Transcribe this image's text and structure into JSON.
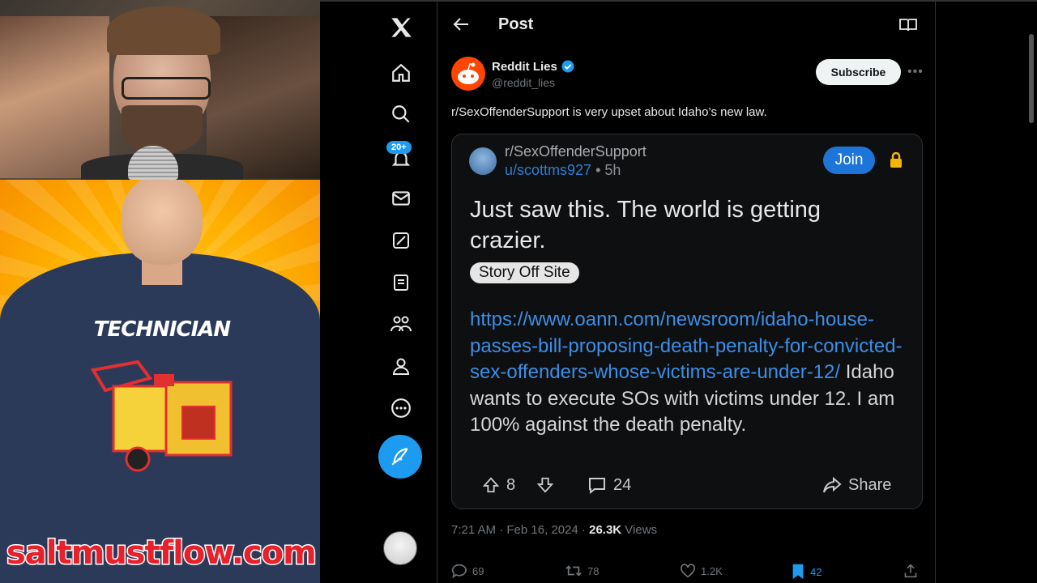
{
  "overlay": {
    "site": "saltmustflow.com",
    "shirt_text": "TECHNICIAN"
  },
  "nav": {
    "notifications_badge": "20+"
  },
  "header": {
    "title": "Post"
  },
  "author": {
    "name": "Reddit Lies",
    "handle": "@reddit_lies",
    "subscribe_label": "Subscribe"
  },
  "tweet": {
    "text": "r/SexOffenderSupport is very upset about Idaho’s new law."
  },
  "reddit": {
    "subreddit": "r/SexOffenderSupport",
    "user": "u/scottms927",
    "time": "• 5h",
    "join_label": "Join",
    "title": "Just saw this. The world is getting crazier.",
    "flair": "Story Off Site",
    "link": "https://www.oann.com/newsroom/idaho-house-passes-bill-proposing-death-penalty-for-convicted-sex-offenders-whose-victims-are-under-12/",
    "body": " Idaho wants to execute SOs with victims under 12. I am 100% against the death penalty.",
    "upvotes": "8",
    "comments": "24",
    "share_label": "Share"
  },
  "meta": {
    "time": "7:21 AM · Feb 16, 2024 · ",
    "views_count": "26.3K",
    "views_label": " Views"
  },
  "stats": {
    "replies": "69",
    "reposts": "78",
    "likes": "1.2K",
    "bookmarks": "42"
  },
  "colors": {
    "accent": "#1d9bf0",
    "reddit_orange": "#ff4500",
    "join_blue": "#1d75d8",
    "link_blue": "#3d8ee6"
  }
}
